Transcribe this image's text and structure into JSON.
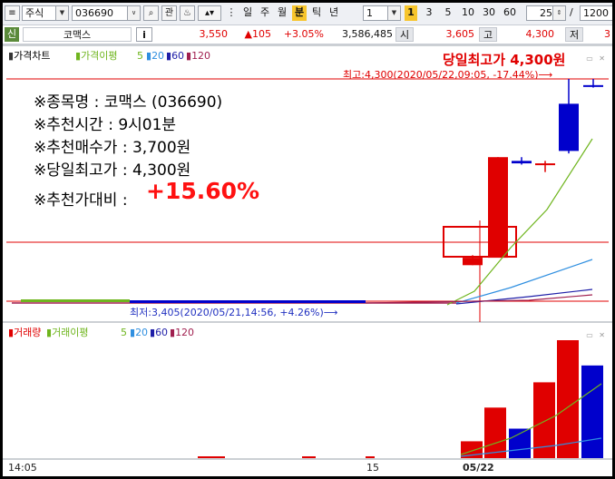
{
  "toolbar": {
    "market_label": "주식",
    "code_value": "036690",
    "btn_relation": "관",
    "periods": [
      "일",
      "주",
      "월",
      "분",
      "틱",
      "년"
    ],
    "active_period": "분",
    "unit_value": "1",
    "minute_buttons": [
      "1",
      "3",
      "5",
      "10",
      "30",
      "60"
    ],
    "active_minute": "1",
    "count_value": "25",
    "slash": "/",
    "total_value": "1200"
  },
  "infobar": {
    "badge": "신",
    "name": "코맥스",
    "info_icon": "i",
    "price": "3,550",
    "change": "▲105",
    "change_pct": "+3.05%",
    "volume": "3,586,485",
    "open_label": "시",
    "open_value": "3,605",
    "high_label": "고",
    "high_value": "4,300",
    "low_label": "저",
    "low_value": "3"
  },
  "price_panel": {
    "legend": [
      "가격차트",
      "가격이평",
      "5",
      "20",
      "60",
      "120"
    ],
    "headline": "당일최고가 4,300원",
    "high_note": "최고:4,300(2020/05/22,09:05, -17.44%)⟶",
    "low_note": "최저:3,405(2020/05/21,14:56, +4.26%)⟶",
    "overlay": [
      "※종목명 : 코맥스 (036690)",
      "※추천시간 : 9시01분",
      "※추천매수가 : 3,700원",
      "※당일최고가 : 4,300원"
    ],
    "compare_label": "※추천가대비 :",
    "compare_value": "+15.60%"
  },
  "volume_panel": {
    "legend": [
      "거래량",
      "거래이평",
      "5",
      "20",
      "60",
      "120"
    ]
  },
  "x_axis": {
    "labels": [
      "14:05",
      "15",
      "05/22"
    ]
  },
  "colors": {
    "up": "#e00000",
    "down": "#0000cc",
    "ma5": "#6fb51e",
    "ma20": "#2f8fe0",
    "ma60": "#1f1fa8",
    "ma120": "#a01f4f",
    "accent": "#f7c52c"
  },
  "chart_data": [
    {
      "type": "line",
      "panel": "price",
      "x_labels": [
        "14:05",
        "15",
        "05/22"
      ],
      "candles": [
        {
          "open": 3550,
          "high": 3590,
          "low": 3550,
          "close": 3580
        },
        {
          "open": 3580,
          "high": 3985,
          "low": 3585,
          "close": 3985
        },
        {
          "open": 3970,
          "high": 3985,
          "low": 3955,
          "close": 3960
        },
        {
          "open": 3960,
          "high": 3970,
          "low": 3925,
          "close": 3960
        },
        {
          "open": 4200,
          "high": 4300,
          "low": 4000,
          "close": 4010
        },
        {
          "open": 4275,
          "high": 4300,
          "low": 4265,
          "close": 4270
        }
      ],
      "high": 4300,
      "low": 3405
    },
    {
      "type": "bar",
      "panel": "volume",
      "values": [
        20,
        60,
        35,
        90,
        140,
        110
      ],
      "colors": [
        "up",
        "up",
        "down",
        "up",
        "up",
        "down"
      ]
    }
  ]
}
